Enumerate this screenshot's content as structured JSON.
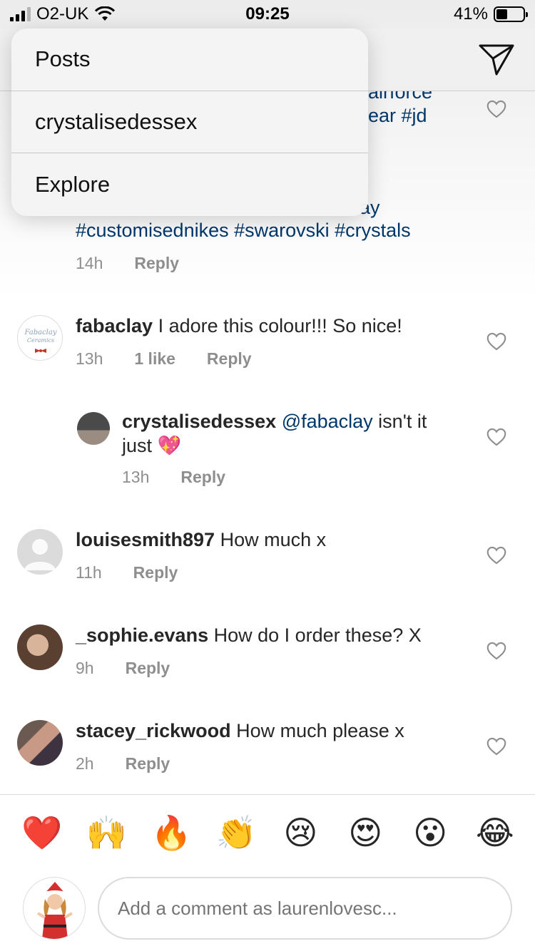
{
  "status_bar": {
    "carrier": "O2-UK",
    "time": "09:25",
    "battery": "41%",
    "battery_level": 0.41
  },
  "dropdown": {
    "items": [
      "Posts",
      "crystalisedessex",
      "Explore"
    ]
  },
  "caption": {
    "line1": "airforce",
    "line2": "ear #jd",
    "line3": "ay",
    "line4": "#customisednikes #swarovski #crystals",
    "time": "14h",
    "reply": "Reply"
  },
  "comments": [
    {
      "username": "fabaclay",
      "text": " I adore this colour!!! So nice!",
      "time": "13h",
      "likes": "1 like",
      "reply": "Reply"
    },
    {
      "username": "crystalisedessex",
      "mention": "@fabaclay",
      "text": " isn't it",
      "text2": "just 💖",
      "time": "13h",
      "reply": "Reply"
    },
    {
      "username": "louisesmith897",
      "text": " How much x",
      "time": "11h",
      "reply": "Reply"
    },
    {
      "username": "_sophie.evans",
      "text": " How do I order these? X",
      "time": "9h",
      "reply": "Reply"
    },
    {
      "username": "stacey_rickwood",
      "text": " How much please x",
      "time": "2h",
      "reply": "Reply"
    }
  ],
  "avatar_labels": {
    "fabaclay_line1": "Fabaclay",
    "fabaclay_line2": "Ceramics"
  },
  "emojis": [
    "❤️",
    "🙌",
    "🔥",
    "👏",
    "😢",
    "😍",
    "😮",
    "😂"
  ],
  "composer": {
    "placeholder": "Add a comment as laurenlovesc..."
  }
}
